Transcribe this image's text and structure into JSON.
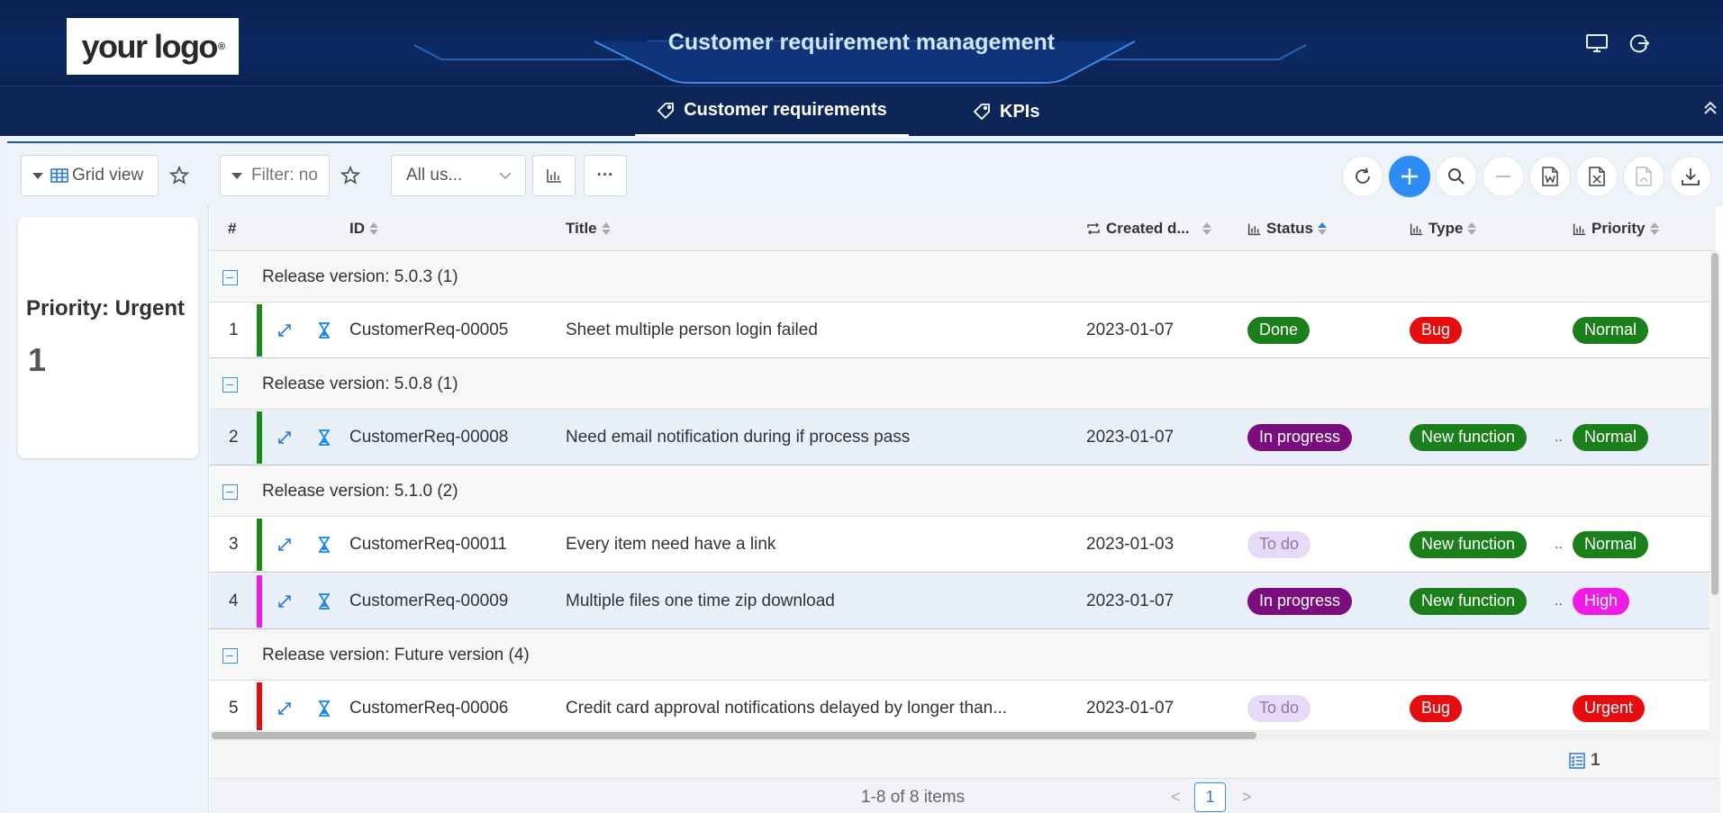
{
  "header": {
    "logo_text": "your logo",
    "logo_mark": "®",
    "title": "Customer requirement management",
    "icons": [
      "monitor-icon",
      "refresh-logout-icon"
    ]
  },
  "tabs": [
    {
      "label": "Customer requirements",
      "active": true
    },
    {
      "label": "KPIs",
      "active": false
    }
  ],
  "toolbar": {
    "view_label": "Grid view",
    "filter_label": "Filter: no",
    "users_select": "All us...",
    "more_label": "···"
  },
  "kpi": {
    "label": "Priority: Urgent",
    "value": "1"
  },
  "columns": {
    "num": "#",
    "id": "ID",
    "title": "Title",
    "created": "Created d...",
    "status": "Status",
    "type": "Type",
    "priority": "Priority"
  },
  "groups": [
    {
      "label": "Release version: 5.0.3 (1)"
    },
    {
      "label": "Release version: 5.0.8 (1)"
    },
    {
      "label": "Release version: 5.1.0 (2)"
    },
    {
      "label": "Release version: Future version (4)"
    }
  ],
  "rows": [
    {
      "num": "1",
      "id": "CustomerReq-00005",
      "title": "Sheet multiple person login failed",
      "created": "2023-01-07",
      "status": "Done",
      "type": "Bug",
      "priority": "Normal"
    },
    {
      "num": "2",
      "id": "CustomerReq-00008",
      "title": "Need email notification during if process pass",
      "created": "2023-01-07",
      "status": "In progress",
      "type": "New function",
      "priority": "Normal",
      "more": ".."
    },
    {
      "num": "3",
      "id": "CustomerReq-00011",
      "title": "Every item need have a link",
      "created": "2023-01-03",
      "status": "To do",
      "type": "New function",
      "priority": "Normal",
      "more": ".."
    },
    {
      "num": "4",
      "id": "CustomerReq-00009",
      "title": "Multiple files one time zip download",
      "created": "2023-01-07",
      "status": "In progress",
      "type": "New function",
      "priority": "High",
      "more": ".."
    },
    {
      "num": "5",
      "id": "CustomerReq-00006",
      "title": "Credit card approval notifications delayed by longer than...",
      "created": "2023-01-07",
      "status": "To do",
      "type": "Bug",
      "priority": "Urgent"
    }
  ],
  "colors": {
    "done": "#1b7f1b",
    "in_progress": "#7a0e7e",
    "todo_bg": "#e6daf7",
    "todo_fg": "#8a78a8",
    "bug": "#e50d0d",
    "new_function": "#1b7f1b",
    "normal": "#1b7f1b",
    "high": "#f01be6",
    "urgent": "#e50d0d",
    "bar_green": "#1b8a1b",
    "bar_magenta": "#f01be6",
    "bar_red": "#e50d0d"
  },
  "footer": {
    "selected_count": "1",
    "pager_text": "1-8 of 8 items",
    "prev": "<",
    "page": "1",
    "next": ">"
  }
}
